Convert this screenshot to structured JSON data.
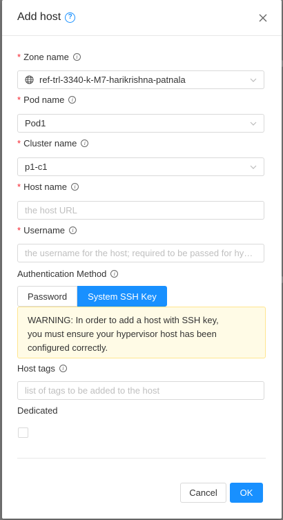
{
  "modal": {
    "title": "Add host",
    "fields": {
      "zone": {
        "label": "Zone name",
        "value": "ref-trl-3340-k-M7-harikrishna-patnala"
      },
      "pod": {
        "label": "Pod name",
        "value": "Pod1"
      },
      "cluster": {
        "label": "Cluster name",
        "value": "p1-c1"
      },
      "hostname": {
        "label": "Host name",
        "placeholder": "the host URL"
      },
      "username": {
        "label": "Username",
        "placeholder": "the username for the host; required to be passed for hyper…"
      },
      "auth": {
        "label": "Authentication Method",
        "options": [
          "Password",
          "System SSH Key"
        ],
        "selected": "System SSH Key"
      },
      "hosttags": {
        "label": "Host tags",
        "placeholder": "list of tags to be added to the host"
      },
      "dedicated": {
        "label": "Dedicated",
        "checked": false
      }
    },
    "warning": {
      "line1": "WARNING: In order to add a host with SSH key,",
      "line2": "you must ensure your hypervisor host has been",
      "line3": "configured correctly."
    },
    "buttons": {
      "cancel": "Cancel",
      "ok": "OK"
    }
  },
  "colors": {
    "primary": "#1890ff",
    "required": "#f5222d",
    "warning_bg": "#fffbe6",
    "warning_border": "#ffe58f"
  },
  "icons": [
    "help-icon",
    "close-icon",
    "info-icon",
    "globe-icon",
    "chevron-down-icon"
  ]
}
